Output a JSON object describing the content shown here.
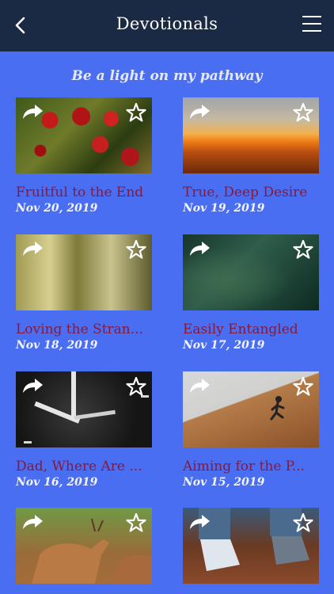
{
  "header": {
    "title": "Devotionals",
    "back_icon": "chevron-left-icon",
    "menu_icon": "hamburger-menu-icon"
  },
  "subtitle": "Be a light on my pathway",
  "colors": {
    "header_bg": "#1b2a44",
    "page_bg": "#4a6ef2",
    "card_title": "#8a1838",
    "card_date": "#f1f3ff"
  },
  "cards": [
    {
      "title": "Fruitful to the End",
      "date": "Nov 20, 2019"
    },
    {
      "title": "True, Deep Desire",
      "date": "Nov 19, 2019"
    },
    {
      "title": "Loving the Stran...",
      "date": "Nov 18, 2019"
    },
    {
      "title": "Easily Entangled",
      "date": "Nov 17, 2019"
    },
    {
      "title": "Dad, Where Are ...",
      "date": "Nov 16, 2019"
    },
    {
      "title": "Aiming for the P...",
      "date": "Nov 15, 2019"
    },
    {
      "title": "",
      "date": ""
    },
    {
      "title": "",
      "date": ""
    }
  ]
}
